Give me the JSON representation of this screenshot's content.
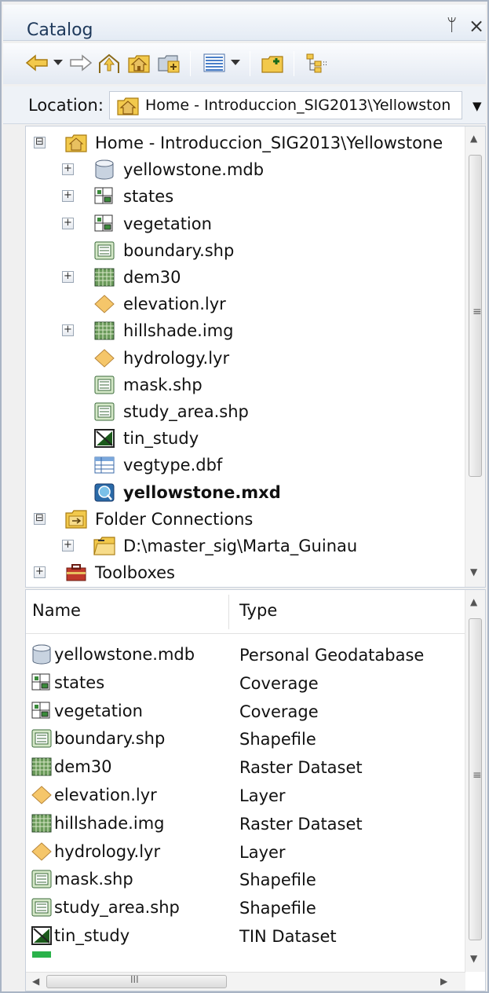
{
  "window": {
    "title": "Catalog",
    "pin_glyph": "ᛘ",
    "close_glyph": "×"
  },
  "toolbar": {
    "buttons": [
      {
        "name": "back-button",
        "icon": "arrow-left-icon"
      },
      {
        "name": "back-dropdown-button",
        "icon": "chevron-down-icon"
      },
      {
        "name": "forward-button",
        "icon": "arrow-right-icon"
      },
      {
        "name": "up-one-level-button",
        "icon": "up-folder-icon"
      },
      {
        "name": "home-button",
        "icon": "home-folder-icon"
      },
      {
        "name": "connect-to-folder-button",
        "icon": "connect-folder-icon"
      },
      {
        "name": "view-options-button",
        "icon": "list-view-icon"
      },
      {
        "name": "view-dropdown-button",
        "icon": "chevron-down-icon"
      },
      {
        "name": "new-folder-button",
        "icon": "new-folder-icon"
      },
      {
        "name": "toggle-tree-button",
        "icon": "tree-icon"
      }
    ]
  },
  "location": {
    "label": "Location:",
    "value": "Home - Introduccion_SIG2013\\Yellowston",
    "icon": "home-folder-icon"
  },
  "tree": {
    "items": [
      {
        "label": "Home - Introduccion_SIG2013\\Yellowstone",
        "icon": "home-folder-icon",
        "expander": "⊟",
        "bold": false
      },
      {
        "label": "yellowstone.mdb",
        "icon": "geodatabase-icon",
        "expander": "+",
        "bold": false
      },
      {
        "label": "states",
        "icon": "coverage-icon",
        "expander": "+",
        "bold": false
      },
      {
        "label": "vegetation",
        "icon": "coverage-icon",
        "expander": "+",
        "bold": false
      },
      {
        "label": "boundary.shp",
        "icon": "shapefile-icon",
        "expander": "",
        "bold": false
      },
      {
        "label": "dem30",
        "icon": "raster-icon",
        "expander": "+",
        "bold": false
      },
      {
        "label": "elevation.lyr",
        "icon": "layer-icon",
        "expander": "",
        "bold": false
      },
      {
        "label": "hillshade.img",
        "icon": "raster-icon",
        "expander": "+",
        "bold": false
      },
      {
        "label": "hydrology.lyr",
        "icon": "layer-icon",
        "expander": "",
        "bold": false
      },
      {
        "label": "mask.shp",
        "icon": "shapefile-icon",
        "expander": "",
        "bold": false
      },
      {
        "label": "study_area.shp",
        "icon": "shapefile-icon",
        "expander": "",
        "bold": false
      },
      {
        "label": "tin_study",
        "icon": "tin-icon",
        "expander": "",
        "bold": false
      },
      {
        "label": "vegtype.dbf",
        "icon": "table-icon",
        "expander": "",
        "bold": false
      },
      {
        "label": "yellowstone.mxd",
        "icon": "map-document-icon",
        "expander": "",
        "bold": true
      },
      {
        "label": "Folder Connections",
        "icon": "folder-connections-icon",
        "expander": "⊟",
        "bold": false
      },
      {
        "label": "D:\\master_sig\\Marta_Guinau",
        "icon": "folder-icon",
        "expander": "+",
        "bold": false
      },
      {
        "label": "Toolboxes",
        "icon": "toolbox-icon",
        "expander": "+",
        "bold": false
      }
    ]
  },
  "contents": {
    "columns": [
      "Name",
      "Type"
    ],
    "rows": [
      {
        "name": "yellowstone.mdb",
        "type": "Personal Geodatabase",
        "icon": "geodatabase-icon"
      },
      {
        "name": "states",
        "type": "Coverage",
        "icon": "coverage-icon"
      },
      {
        "name": "vegetation",
        "type": "Coverage",
        "icon": "coverage-icon"
      },
      {
        "name": "boundary.shp",
        "type": "Shapefile",
        "icon": "shapefile-icon"
      },
      {
        "name": "dem30",
        "type": "Raster Dataset",
        "icon": "raster-icon"
      },
      {
        "name": "elevation.lyr",
        "type": "Layer",
        "icon": "layer-icon"
      },
      {
        "name": "hillshade.img",
        "type": "Raster Dataset",
        "icon": "raster-icon"
      },
      {
        "name": "hydrology.lyr",
        "type": "Layer",
        "icon": "layer-icon"
      },
      {
        "name": "mask.shp",
        "type": "Shapefile",
        "icon": "shapefile-icon"
      },
      {
        "name": "study_area.shp",
        "type": "Shapefile",
        "icon": "shapefile-icon"
      },
      {
        "name": "tin_study",
        "type": "TIN Dataset",
        "icon": "tin-icon"
      }
    ]
  },
  "colors": {
    "title_text": "#1e395b",
    "window_border": "#a9b4c4",
    "pane_background": "#ffffff"
  }
}
